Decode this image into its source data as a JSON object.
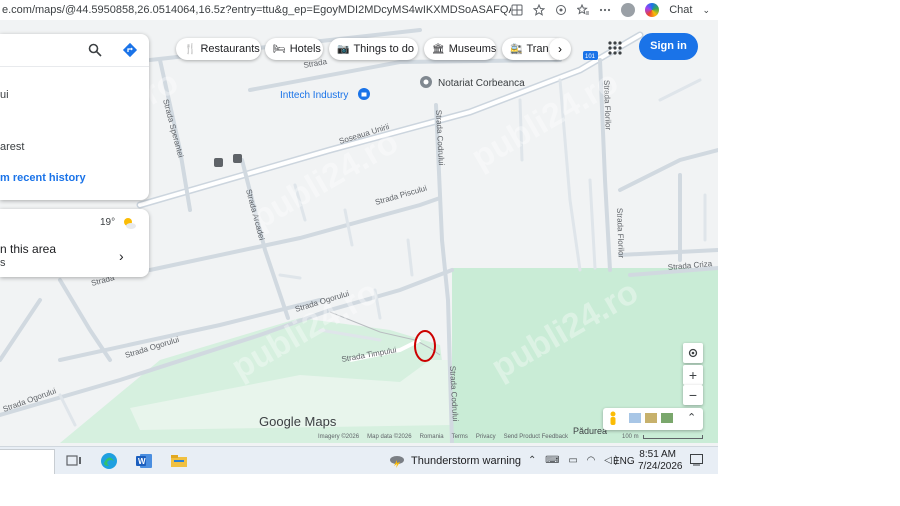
{
  "browser": {
    "url": "e.com/maps/@44.5950858,26.0514064,16.5z?entry=ttu&g_ep=EgoyMDI2MDcyMS4wIKXMDSoASAFQAw%3D%...",
    "chat_label": "Chat"
  },
  "panel": {
    "partial_text_1": "ui",
    "partial_text_2": "arest",
    "recent_history": "m recent history"
  },
  "weather_card": {
    "temp": "19°",
    "line1": "n this area",
    "line2": "s"
  },
  "chips": [
    {
      "label": "Restaurants",
      "icon": "fork-knife-icon"
    },
    {
      "label": "Hotels",
      "icon": "bed-icon"
    },
    {
      "label": "Things to do",
      "icon": "camera-icon"
    },
    {
      "label": "Museums",
      "icon": "museum-icon"
    },
    {
      "label": "Transi",
      "icon": "transit-icon"
    }
  ],
  "sign_in": "Sign in",
  "places": [
    {
      "name": "Notariat Corbeanca"
    },
    {
      "name": "Inttech Industry"
    }
  ],
  "streets": {
    "s1": "Strada",
    "speranteii": "Strada Sperantei",
    "soseaua": "Soseaua Unirii",
    "floriior1": "Strada Florilor",
    "floriior2": "Strada Florilor",
    "codrului1": "Strada Codrului",
    "piscului": "Strada Piscului",
    "arcadei": "Strada Arcadei",
    "ogorului1": "Strada Ogorului",
    "ogorului2": "Strada Ogorului",
    "ogorului3": "Strada Ogorului",
    "timpului": "Strada Timpului",
    "codrului2": "Strada Codrului",
    "crizant": "Strada Criza",
    "strada_left": "Strada",
    "padurea": "Pădurea"
  },
  "road_badge": "101",
  "map_footer": {
    "logo": "Google Maps",
    "links": [
      "Imagery ©2026",
      "Map data ©2026",
      "Romania",
      "Terms",
      "Privacy",
      "Send Product Feedback"
    ],
    "scale": "100 m"
  },
  "taskbar": {
    "weather_text": "Thunderstorm warning",
    "language": "ENG",
    "time": "8:51 AM",
    "date": "7/24/2026"
  },
  "watermark": "publi24.ro",
  "colors": {
    "accent": "#1a73e8",
    "park": "#c9ecd6",
    "road": "#c5d0db",
    "marker_circle": "#cc0000"
  }
}
